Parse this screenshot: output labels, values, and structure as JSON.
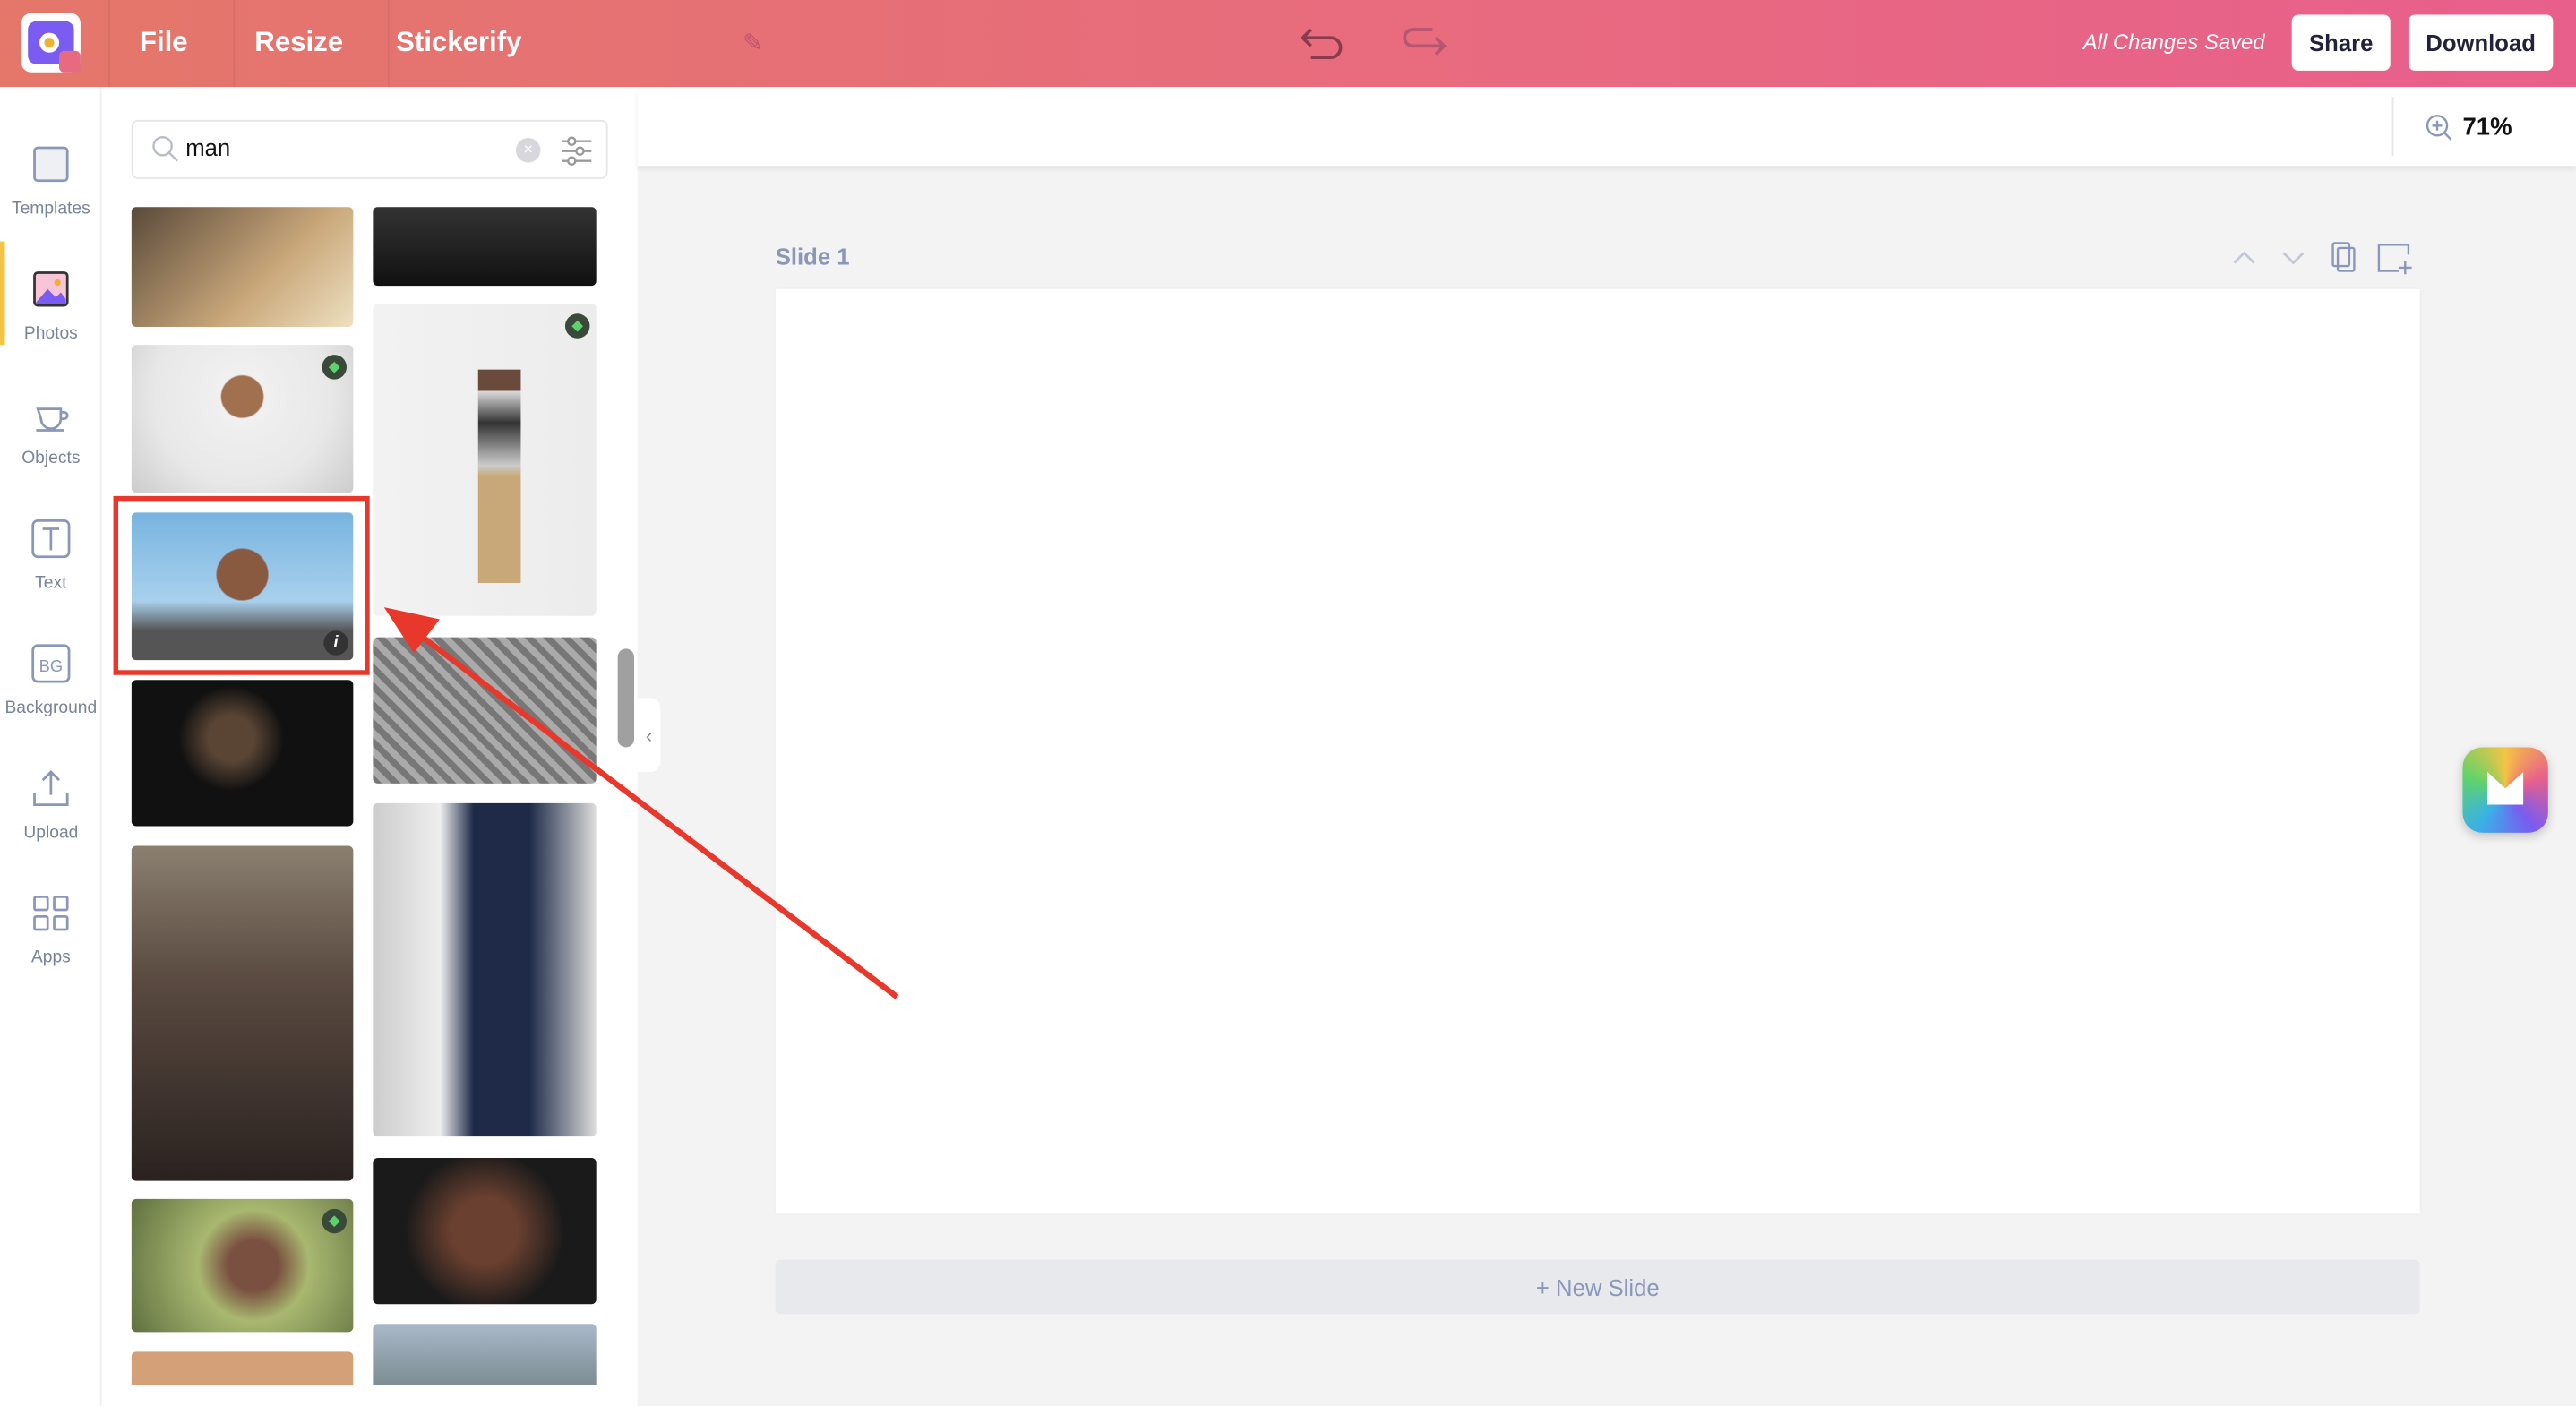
{
  "topbar": {
    "menu": [
      "File",
      "Resize",
      "Stickerify"
    ],
    "status": "All Changes Saved",
    "share_label": "Share",
    "download_label": "Download",
    "gradient": [
      "#e4776a",
      "#e85f8c"
    ]
  },
  "sidebar": {
    "active": "Photos",
    "items": [
      {
        "label": "Templates",
        "icon": "templates-icon"
      },
      {
        "label": "Photos",
        "icon": "photos-icon"
      },
      {
        "label": "Objects",
        "icon": "objects-icon"
      },
      {
        "label": "Text",
        "icon": "text-icon"
      },
      {
        "label": "Background",
        "icon": "background-icon"
      },
      {
        "label": "Upload",
        "icon": "upload-icon"
      },
      {
        "label": "Apps",
        "icon": "apps-icon"
      }
    ]
  },
  "search": {
    "value": "man"
  },
  "photos": {
    "info_badge": "i",
    "highlight_color": "#e8382b"
  },
  "canvas": {
    "zoom": "71%",
    "slide_title": "Slide 1",
    "new_slide_label": "+ New Slide"
  }
}
